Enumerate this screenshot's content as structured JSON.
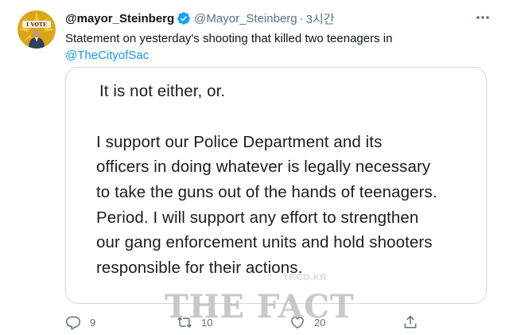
{
  "tweet": {
    "display_name": "@mayor_Steinberg",
    "handle": "@Mayor_Steinberg",
    "separator": "·",
    "time": "3시간",
    "text_prefix": "Statement on yesterday's shooting that killed two teenagers in",
    "mention": "@TheCityofSac",
    "avatar_label": "I VOTE",
    "icons": {
      "verified": "verified-badge-icon",
      "more": "more-horizontal-icon",
      "reply": "reply-icon",
      "retweet": "retweet-icon",
      "like": "heart-icon",
      "share": "share-icon"
    },
    "accent_color": "#1b95e0"
  },
  "media": {
    "lines": [
      "It is not either, or.",
      "I support our Police Department and its",
      "officers in doing whatever is legally necessary",
      "to take the guns out of the hands of teenagers.",
      "Period. I will support any effort to strengthen",
      "our gang enforcement units and hold shooters",
      "responsible for their actions."
    ]
  },
  "actions": {
    "reply_count": "9",
    "retweet_count": "10",
    "like_count": "20"
  },
  "watermark": {
    "small": "TF.CO.KR",
    "big": "THE FACT"
  }
}
